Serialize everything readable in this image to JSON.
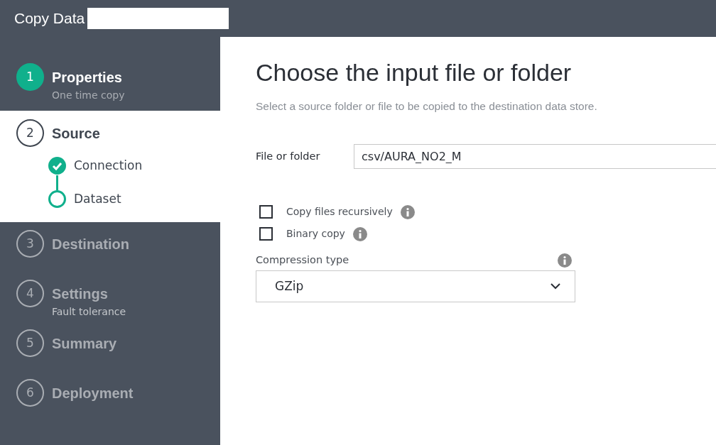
{
  "window": {
    "title": "Copy Data"
  },
  "steps": [
    {
      "number": "1",
      "label": "Properties",
      "subtitle": "One time copy",
      "completed": true,
      "selected": false
    },
    {
      "number": "2",
      "label": "Source",
      "completed": false,
      "selected": true,
      "substeps": [
        {
          "label": "Connection",
          "done": true
        },
        {
          "label": "Dataset",
          "done": false
        }
      ]
    },
    {
      "number": "3",
      "label": "Destination",
      "completed": false,
      "selected": false
    },
    {
      "number": "4",
      "label": "Settings",
      "subtitle": "Fault tolerance",
      "completed": false,
      "selected": false
    },
    {
      "number": "5",
      "label": "Summary",
      "completed": false,
      "selected": false
    },
    {
      "number": "6",
      "label": "Deployment",
      "completed": false,
      "selected": false
    }
  ],
  "main": {
    "heading": "Choose the input file or folder",
    "description": "Select a source folder or file to be copied to the destination data store.",
    "file_field": {
      "label": "File or folder",
      "value": "csv/AURA_NO2_M"
    },
    "checkboxes": [
      {
        "label": "Copy files recursively",
        "checked": false
      },
      {
        "label": "Binary copy",
        "checked": false
      }
    ],
    "compression": {
      "label": "Compression type",
      "value": "GZip"
    }
  }
}
